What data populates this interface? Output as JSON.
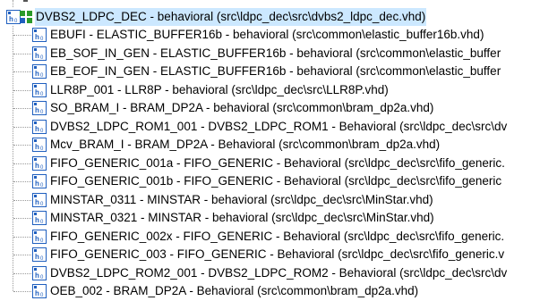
{
  "tree": {
    "root": {
      "label": "DVBS2_LDPC_DEC - behavioral (src\\ldpc_dec\\src\\dvbs2_ldpc_dec.vhd)",
      "icon": "vhdl-entity-icon",
      "selected": true
    },
    "children": [
      {
        "label": "EBUFI - ELASTIC_BUFFER16b - behavioral (src\\common\\elastic_buffer16b.vhd)"
      },
      {
        "label": "EB_SOF_IN_GEN - ELASTIC_BUFFER16b - behavioral (src\\common\\elastic_buffer"
      },
      {
        "label": "EB_EOF_IN_GEN - ELASTIC_BUFFER16b - behavioral (src\\common\\elastic_buffer"
      },
      {
        "label": "LLR8P_001 - LLR8P - behavioral (src\\ldpc_dec\\src\\LLR8P.vhd)"
      },
      {
        "label": "SO_BRAM_I - BRAM_DP2A - behavioral (src\\common\\bram_dp2a.vhd)"
      },
      {
        "label": "DVBS2_LDPC_ROM1_001 - DVBS2_LDPC_ROM1 - Behavioral (src\\ldpc_dec\\src\\dv"
      },
      {
        "label": "Mcv_BRAM_I - BRAM_DP2A - Behavioral (src\\common\\bram_dp2a.vhd)"
      },
      {
        "label": "FIFO_GENERIC_001a - FIFO_GENERIC - Behavioral (src\\ldpc_dec\\src\\fifo_generic."
      },
      {
        "label": "FIFO_GENERIC_001b - FIFO_GENERIC - Behavioral (src\\ldpc_dec\\src\\fifo_generic"
      },
      {
        "label": "MINSTAR_0311 - MINSTAR - behavioral (src\\ldpc_dec\\src\\MinStar.vhd)"
      },
      {
        "label": "MINSTAR_0321 - MINSTAR - behavioral (src\\ldpc_dec\\src\\MinStar.vhd)"
      },
      {
        "label": "FIFO_GENERIC_002x - FIFO_GENERIC - Behavioral (src\\ldpc_dec\\src\\fifo_generic."
      },
      {
        "label": "FIFO_GENERIC_003 - FIFO_GENERIC - Behavioral (src\\ldpc_dec\\src\\fifo_generic.v"
      },
      {
        "label": "DVBS2_LDPC_ROM2_001 - DVBS2_LDPC_ROM2 - Behavioral (src\\ldpc_dec\\src\\dv"
      },
      {
        "label": "OEB_002 - BRAM_DP2A - Behavioral (src\\common\\bram_dp2a.vhd)"
      }
    ],
    "child_icon": "vhdl-module-icon",
    "colors": {
      "selection": "#cce8ff",
      "icon_blue": "#1f5fbf",
      "icon_green": "#2a9a2a"
    }
  }
}
